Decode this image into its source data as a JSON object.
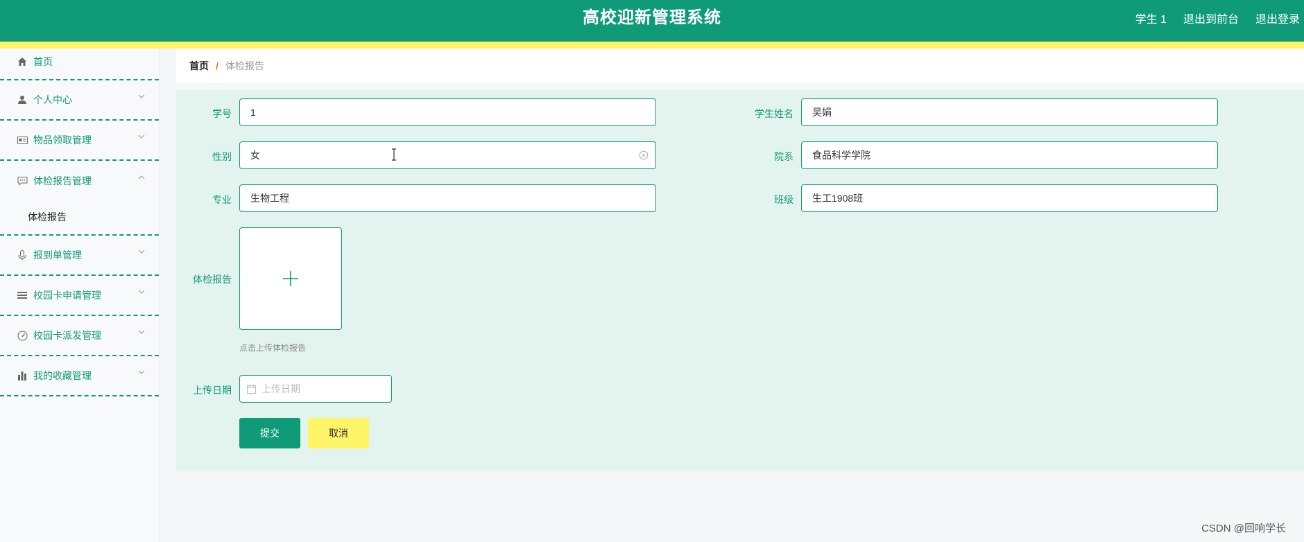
{
  "header": {
    "title": "高校迎新管理系统",
    "user": "学生 1",
    "to_front": "退出到前台",
    "logout": "退出登录"
  },
  "colors": {
    "primary": "#0f9a78",
    "accent_yellow": "#fff566",
    "panel_bg": "#e3f4ef"
  },
  "sidebar": {
    "home": {
      "label": "首页",
      "icon": "home-icon"
    },
    "items": [
      {
        "label": "个人中心",
        "icon": "user-icon"
      },
      {
        "label": "物品领取管理",
        "icon": "id-card-icon"
      },
      {
        "label": "体检报告管理",
        "icon": "chat-icon",
        "expanded": true,
        "children": [
          "体检报告"
        ]
      },
      {
        "label": "报到单管理",
        "icon": "microphone-icon"
      },
      {
        "label": "校园卡申请管理",
        "icon": "list-icon"
      },
      {
        "label": "校园卡派发管理",
        "icon": "gauge-icon"
      },
      {
        "label": "我的收藏管理",
        "icon": "bar-chart-icon"
      }
    ]
  },
  "breadcrumb": {
    "home": "首页",
    "separator": "/",
    "current": "体检报告"
  },
  "form": {
    "student_no": {
      "label": "学号",
      "value": "1"
    },
    "student_name": {
      "label": "学生姓名",
      "value": "吴娟"
    },
    "gender": {
      "label": "性别",
      "value": "女"
    },
    "department": {
      "label": "院系",
      "value": "食品科学学院"
    },
    "major": {
      "label": "专业",
      "value": "生物工程"
    },
    "class": {
      "label": "班级",
      "value": "生工1908班"
    },
    "report": {
      "label": "体检报告",
      "tip": "点击上传体检报告"
    },
    "upload_date": {
      "label": "上传日期",
      "placeholder": "上传日期",
      "value": ""
    },
    "submit_label": "提交",
    "cancel_label": "取消"
  },
  "watermark": "CSDN @回响学长"
}
